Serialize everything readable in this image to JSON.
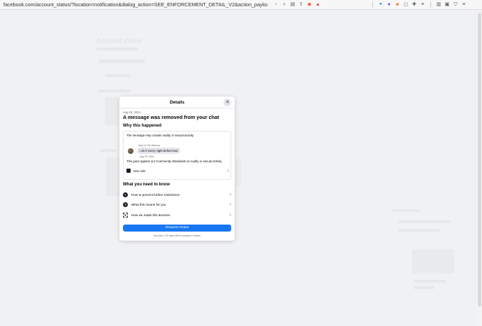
{
  "browser": {
    "url": "facebook.com/account_status/?location=notification&dialog_action=SEE_ENFORCEMENT_DETAIL_V2&action_payload=%7B\"enforcem..."
  },
  "background": {
    "title": "Account status"
  },
  "modal": {
    "title": "Details",
    "close_icon": "close-icon",
    "date": "Aug 19, 2023",
    "headline": "A message was removed from your chat",
    "why_heading": "Why this happened",
    "reason": "The message may contain nudity or sexual activity.",
    "sent_in": "Sent in The Warrma",
    "message": "I do it every night before bed",
    "message_date": "Aug 19, 2023",
    "policy": "This goes against our Community Standards on nudity or sexual activity.",
    "see_rule": "See rule",
    "know_heading": "What you need to know",
    "know_items": [
      {
        "label": "How to prevent further restrictions",
        "icon": "alert-icon"
      },
      {
        "label": "What this means for you",
        "icon": "question-icon"
      },
      {
        "label": "How we made this decision",
        "icon": "scan-icon"
      }
    ],
    "request_button": "Request review",
    "days_left": "You have 179 days left to request a review."
  }
}
